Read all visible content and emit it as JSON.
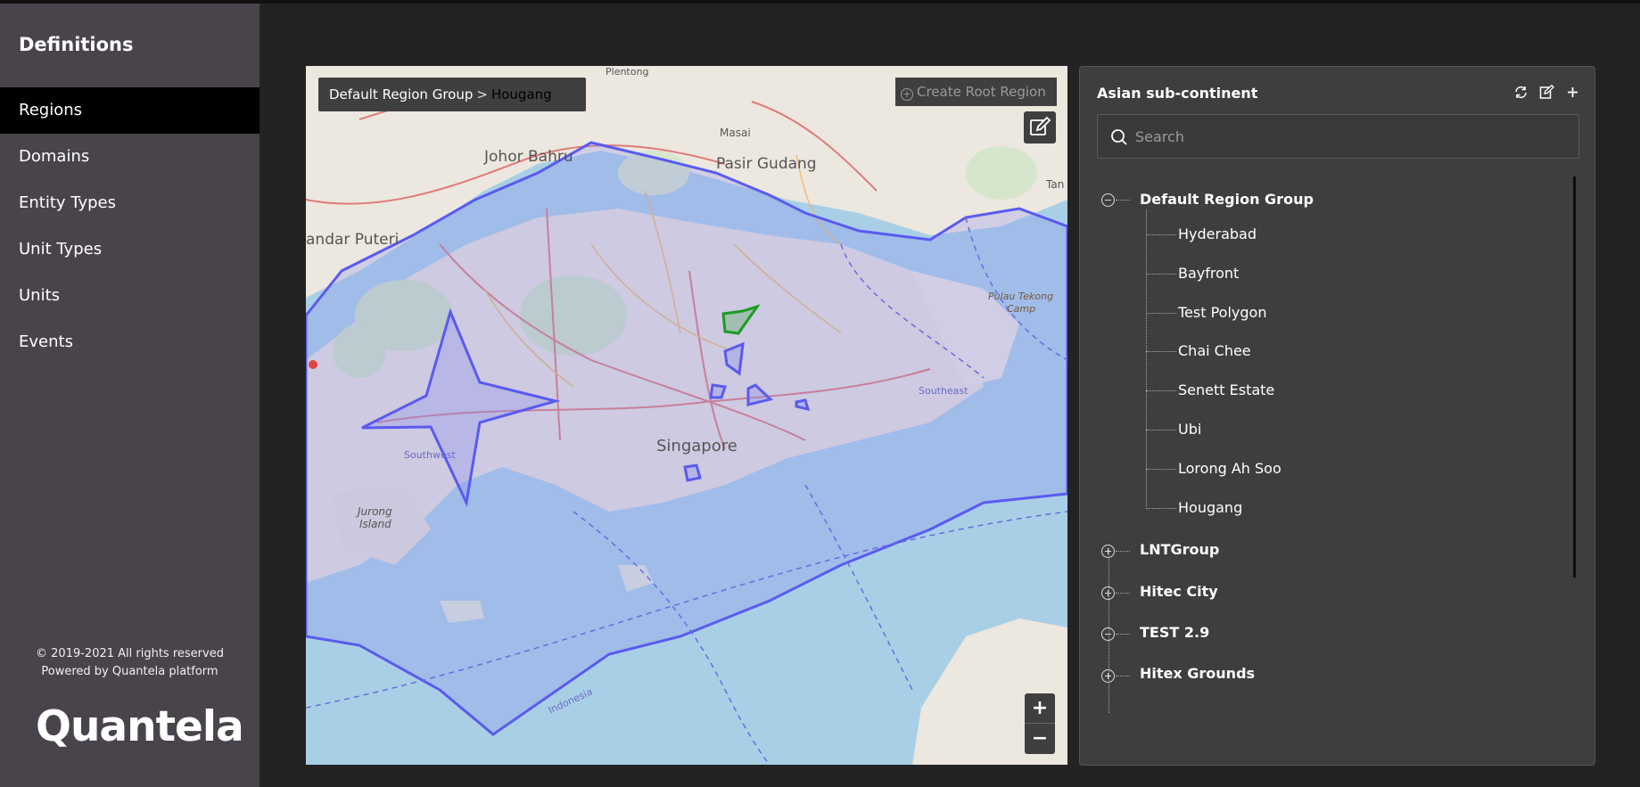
{
  "sidebar": {
    "title": "Definitions",
    "items": [
      {
        "label": "Regions",
        "active": true
      },
      {
        "label": "Domains"
      },
      {
        "label": "Entity Types"
      },
      {
        "label": "Unit Types"
      },
      {
        "label": "Units"
      },
      {
        "label": "Events"
      }
    ],
    "copyright": "© 2019-2021 All rights reserved",
    "powered_by": "Powered by Quantela platform",
    "logo": "Quantela"
  },
  "map": {
    "breadcrumb": {
      "root": "Default Region Group",
      "separator": ">",
      "current": "Hougang"
    },
    "create_root_label": "Create Root Region",
    "zoom_in": "+",
    "zoom_out": "−",
    "labels": {
      "johor_bahru": "Johor Bahru",
      "pasir_gudang": "Pasir Gudang",
      "bandar_puteri": "andar Puteri",
      "singapore": "Singapore",
      "jurong_island_1": "Jurong",
      "jurong_island_2": "Island",
      "pulau_tekong_1": "Pulau Tekong",
      "pulau_tekong_2": "Camp",
      "southeast": "Southeast",
      "southwest": "Southwest",
      "indonesia": "Indonesia",
      "plentong": "Plentong",
      "masai": "Masai",
      "tan": "Tan"
    },
    "colors": {
      "water": "#a9cfe6",
      "land": "#ece7df",
      "region_stroke": "#5a5af0",
      "region_fill": "#8a8cf0",
      "selected": "#1e9a22"
    }
  },
  "panel": {
    "title": "Asian sub-continent",
    "search_placeholder": "Search",
    "actions": [
      "refresh-icon",
      "edit-icon",
      "plus-icon"
    ],
    "tree": [
      {
        "label": "Default Region Group",
        "expanded": true,
        "children": [
          "Hyderabad",
          "Bayfront",
          "Test Polygon",
          "Chai Chee",
          "Senett Estate",
          "Ubi",
          "Lorong Ah Soo",
          "Hougang"
        ]
      },
      {
        "label": "LNTGroup",
        "expanded": false
      },
      {
        "label": "Hitec City",
        "expanded": false
      },
      {
        "label": "TEST 2.9",
        "expanded": true
      },
      {
        "label": "Hitex Grounds",
        "expanded": false
      }
    ]
  }
}
